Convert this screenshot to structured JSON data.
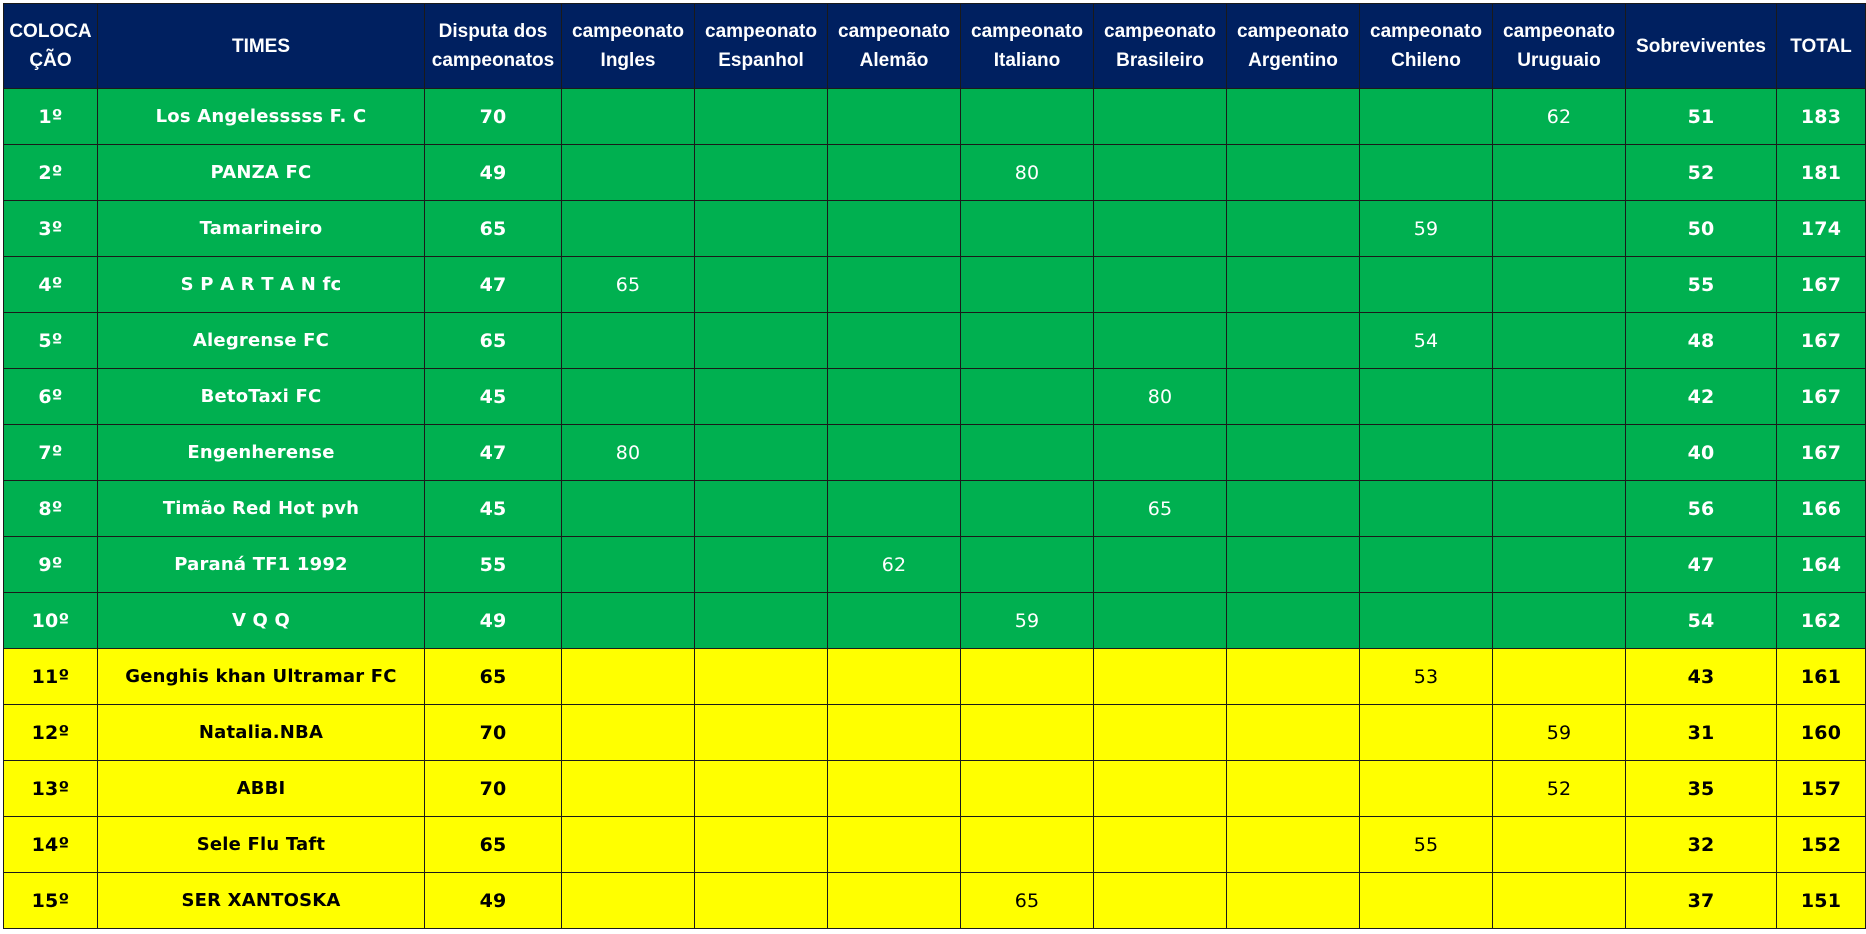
{
  "header": {
    "colocacao": "COLOCA ÇÃO",
    "times": "TIMES",
    "disputa": "Disputa dos campeonatos",
    "ingles": "campeonato Ingles",
    "espanhol": "campeonato Espanhol",
    "alemao": "campeonato Alemão",
    "italiano": "campeonato Italiano",
    "brasileiro": "campeonato Brasileiro",
    "argentino": "campeonato Argentino",
    "chileno": "campeonato Chileno",
    "uruguaio": "campeonato Uruguaio",
    "sobreviventes": "Sobreviventes",
    "total": "TOTAL"
  },
  "colors": {
    "header_bg": "#002060",
    "qualified_bg": "#00b050",
    "second_zone_bg": "#ffff00"
  },
  "rows": [
    {
      "pos": "1º",
      "team": "Los Angelesssss F. C",
      "disputa": "70",
      "ingles": "",
      "espanhol": "",
      "alemao": "",
      "italiano": "",
      "brasileiro": "",
      "argentino": "",
      "chileno": "",
      "uruguaio": "62",
      "sobreviventes": "51",
      "total": "183"
    },
    {
      "pos": "2º",
      "team": "PANZA FC",
      "disputa": "49",
      "ingles": "",
      "espanhol": "",
      "alemao": "",
      "italiano": "80",
      "brasileiro": "",
      "argentino": "",
      "chileno": "",
      "uruguaio": "",
      "sobreviventes": "52",
      "total": "181"
    },
    {
      "pos": "3º",
      "team": "Tamarineiro",
      "disputa": "65",
      "ingles": "",
      "espanhol": "",
      "alemao": "",
      "italiano": "",
      "brasileiro": "",
      "argentino": "",
      "chileno": "59",
      "uruguaio": "",
      "sobreviventes": "50",
      "total": "174"
    },
    {
      "pos": "4º",
      "team": "S P A R T A N fc",
      "disputa": "47",
      "ingles": "65",
      "espanhol": "",
      "alemao": "",
      "italiano": "",
      "brasileiro": "",
      "argentino": "",
      "chileno": "",
      "uruguaio": "",
      "sobreviventes": "55",
      "total": "167"
    },
    {
      "pos": "5º",
      "team": "Alegrense FC",
      "disputa": "65",
      "ingles": "",
      "espanhol": "",
      "alemao": "",
      "italiano": "",
      "brasileiro": "",
      "argentino": "",
      "chileno": "54",
      "uruguaio": "",
      "sobreviventes": "48",
      "total": "167"
    },
    {
      "pos": "6º",
      "team": "BetoTaxi FC",
      "disputa": "45",
      "ingles": "",
      "espanhol": "",
      "alemao": "",
      "italiano": "",
      "brasileiro": "80",
      "argentino": "",
      "chileno": "",
      "uruguaio": "",
      "sobreviventes": "42",
      "total": "167"
    },
    {
      "pos": "7º",
      "team": "Engenherense",
      "disputa": "47",
      "ingles": "80",
      "espanhol": "",
      "alemao": "",
      "italiano": "",
      "brasileiro": "",
      "argentino": "",
      "chileno": "",
      "uruguaio": "",
      "sobreviventes": "40",
      "total": "167"
    },
    {
      "pos": "8º",
      "team": "Timão Red Hot pvh",
      "disputa": "45",
      "ingles": "",
      "espanhol": "",
      "alemao": "",
      "italiano": "",
      "brasileiro": "65",
      "argentino": "",
      "chileno": "",
      "uruguaio": "",
      "sobreviventes": "56",
      "total": "166"
    },
    {
      "pos": "9º",
      "team": "Paraná TF1 1992",
      "disputa": "55",
      "ingles": "",
      "espanhol": "",
      "alemao": "62",
      "italiano": "",
      "brasileiro": "",
      "argentino": "",
      "chileno": "",
      "uruguaio": "",
      "sobreviventes": "47",
      "total": "164"
    },
    {
      "pos": "10º",
      "team": "V Q Q",
      "disputa": "49",
      "ingles": "",
      "espanhol": "",
      "alemao": "",
      "italiano": "59",
      "brasileiro": "",
      "argentino": "",
      "chileno": "",
      "uruguaio": "",
      "sobreviventes": "54",
      "total": "162"
    },
    {
      "pos": "11º",
      "team": "Genghis khan Ultramar FC",
      "disputa": "65",
      "ingles": "",
      "espanhol": "",
      "alemao": "",
      "italiano": "",
      "brasileiro": "",
      "argentino": "",
      "chileno": "53",
      "uruguaio": "",
      "sobreviventes": "43",
      "total": "161"
    },
    {
      "pos": "12º",
      "team": "Natalia.NBA",
      "disputa": "70",
      "ingles": "",
      "espanhol": "",
      "alemao": "",
      "italiano": "",
      "brasileiro": "",
      "argentino": "",
      "chileno": "",
      "uruguaio": "59",
      "sobreviventes": "31",
      "total": "160"
    },
    {
      "pos": "13º",
      "team": "ABBI",
      "disputa": "70",
      "ingles": "",
      "espanhol": "",
      "alemao": "",
      "italiano": "",
      "brasileiro": "",
      "argentino": "",
      "chileno": "",
      "uruguaio": "52",
      "sobreviventes": "35",
      "total": "157"
    },
    {
      "pos": "14º",
      "team": "Sele Flu Taft",
      "disputa": "65",
      "ingles": "",
      "espanhol": "",
      "alemao": "",
      "italiano": "",
      "brasileiro": "",
      "argentino": "",
      "chileno": "55",
      "uruguaio": "",
      "sobreviventes": "32",
      "total": "152"
    },
    {
      "pos": "15º",
      "team": "SER XANTOSKA",
      "disputa": "49",
      "ingles": "",
      "espanhol": "",
      "alemao": "",
      "italiano": "65",
      "brasileiro": "",
      "argentino": "",
      "chileno": "",
      "uruguaio": "",
      "sobreviventes": "37",
      "total": "151"
    }
  ]
}
